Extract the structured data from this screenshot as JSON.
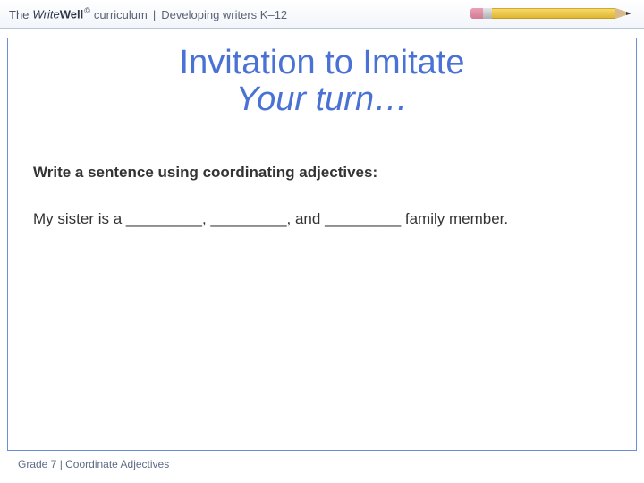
{
  "header": {
    "the": "The",
    "write": "Write",
    "well": "Well",
    "copyright": "©",
    "curriculum": "curriculum",
    "separator": "|",
    "tagline": "Developing writers K–12"
  },
  "slide": {
    "title_line1": "Invitation to Imitate",
    "title_line2": "Your turn…",
    "instruction": "Write a sentence using coordinating adjectives:",
    "sentence": "My sister is a _________, _________, and _________ family member."
  },
  "footer": {
    "text": "Grade 7 | Coordinate Adjectives"
  }
}
